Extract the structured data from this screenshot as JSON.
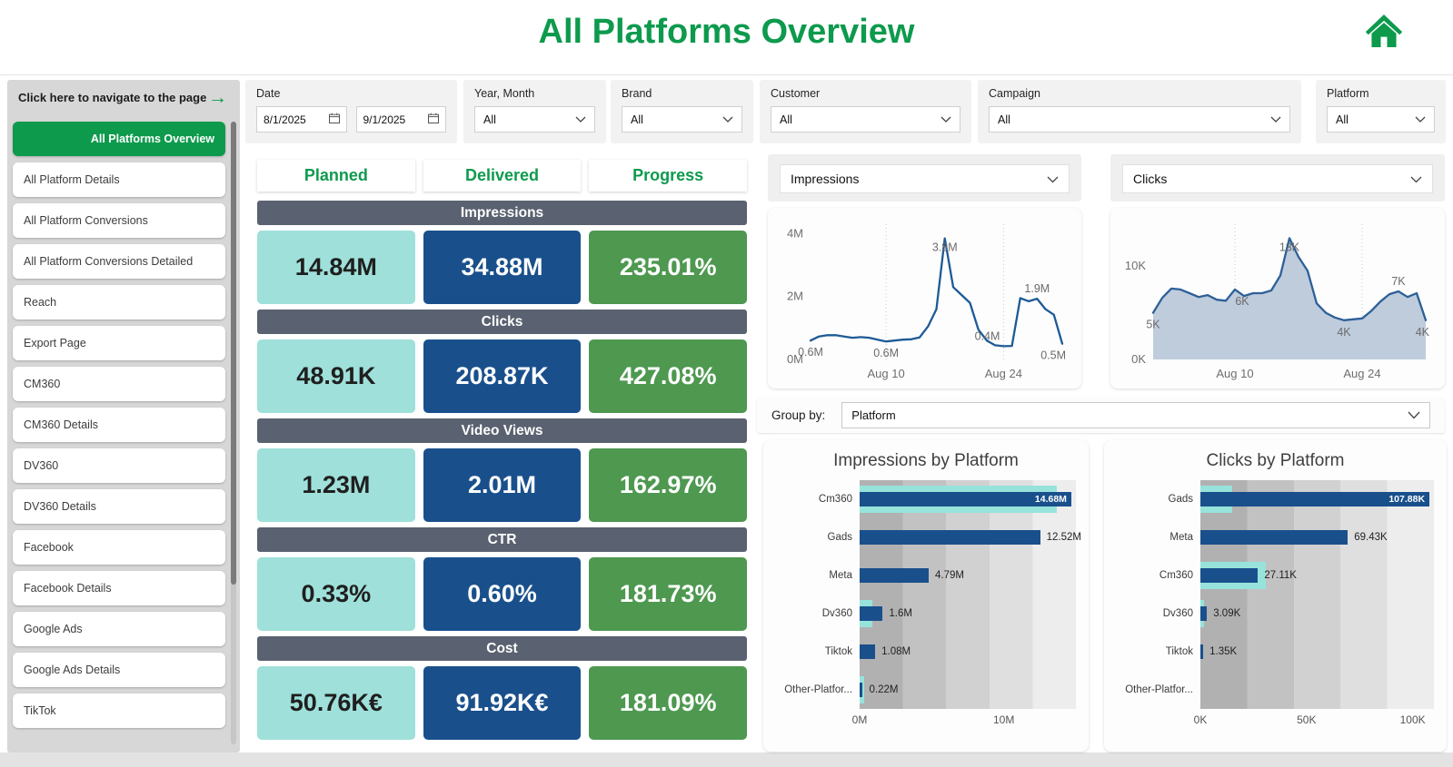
{
  "header": {
    "title": "All Platforms Overview"
  },
  "sidebar": {
    "nav_hint": "Click here to navigate to the page",
    "items": [
      {
        "label": "All Platforms Overview",
        "active": true
      },
      {
        "label": "All Platform Details",
        "active": false
      },
      {
        "label": "All Platform Conversions",
        "active": false
      },
      {
        "label": "All Platform Conversions Detailed",
        "active": false
      },
      {
        "label": "Reach",
        "active": false
      },
      {
        "label": "Export Page",
        "active": false
      },
      {
        "label": "CM360",
        "active": false
      },
      {
        "label": "CM360 Details",
        "active": false
      },
      {
        "label": "DV360",
        "active": false
      },
      {
        "label": "DV360 Details",
        "active": false
      },
      {
        "label": "Facebook",
        "active": false
      },
      {
        "label": "Facebook Details",
        "active": false
      },
      {
        "label": "Google Ads",
        "active": false
      },
      {
        "label": "Google Ads Details",
        "active": false
      },
      {
        "label": "TikTok",
        "active": false
      }
    ]
  },
  "filters": [
    {
      "label": "Date",
      "type": "daterange",
      "from": "8/1/2025",
      "to": "9/1/2025"
    },
    {
      "label": "Year, Month",
      "type": "dropdown",
      "value": "All"
    },
    {
      "label": "Brand",
      "type": "dropdown",
      "value": "All"
    },
    {
      "label": "Customer",
      "type": "dropdown",
      "value": "All"
    },
    {
      "label": "Campaign",
      "type": "dropdown",
      "value": "All"
    },
    {
      "label": "Platform",
      "type": "dropdown",
      "value": "All"
    }
  ],
  "kpi": {
    "columns": [
      "Planned",
      "Delivered",
      "Progress"
    ],
    "metrics": [
      {
        "name": "Impressions",
        "planned": "14.84M",
        "delivered": "34.88M",
        "progress": "235.01%"
      },
      {
        "name": "Clicks",
        "planned": "48.91K",
        "delivered": "208.87K",
        "progress": "427.08%"
      },
      {
        "name": "Video Views",
        "planned": "1.23M",
        "delivered": "2.01M",
        "progress": "162.97%"
      },
      {
        "name": "CTR",
        "planned": "0.33%",
        "delivered": "0.60%",
        "progress": "181.73%"
      },
      {
        "name": "Cost",
        "planned": "50.76K€",
        "delivered": "91.92K€",
        "progress": "181.09%"
      }
    ]
  },
  "group_by": {
    "label": "Group by:",
    "value": "Platform"
  },
  "chart_data": [
    {
      "type": "line",
      "selector_label": "Impressions",
      "x_range": "Aug 1 - Aug 31",
      "unit": "M",
      "values": [
        0.6,
        0.73,
        0.77,
        0.77,
        0.73,
        0.69,
        0.71,
        0.69,
        0.63,
        0.57,
        0.6,
        0.63,
        0.64,
        0.7,
        1.05,
        1.6,
        3.85,
        2.3,
        2.05,
        1.8,
        0.95,
        0.6,
        0.45,
        0.42,
        0.43,
        1.95,
        1.85,
        1.93,
        1.6,
        1.42,
        0.5
      ],
      "ylim": [
        0,
        4.3
      ],
      "yticks": [
        {
          "v": 0,
          "label": "0M"
        },
        {
          "v": 2,
          "label": "2M"
        },
        {
          "v": 4,
          "label": "4M"
        }
      ],
      "xticks": [
        {
          "i": 9,
          "label": "Aug 10"
        },
        {
          "i": 23,
          "label": "Aug 24"
        }
      ],
      "point_labels": [
        {
          "i": 0,
          "text": "0.6M",
          "pos": "below"
        },
        {
          "i": 9,
          "text": "0.6M",
          "pos": "below"
        },
        {
          "i": 16,
          "text": "3.8M",
          "pos": "peak"
        },
        {
          "i": 23,
          "text": "0.4M",
          "pos": "above",
          "anchor": "end",
          "dx": -4
        },
        {
          "i": 27,
          "text": "1.9M",
          "pos": "above"
        },
        {
          "i": 30,
          "text": "0.5M",
          "pos": "below",
          "anchor": "end",
          "dx": 4
        }
      ],
      "fill": false
    },
    {
      "type": "area",
      "selector_label": "Clicks",
      "x_range": "Aug 1 - Aug 31",
      "unit": "K",
      "values": [
        5.0,
        6.6,
        7.6,
        7.5,
        7.1,
        6.7,
        6.9,
        6.4,
        6.3,
        7.5,
        6.8,
        7.1,
        7.1,
        7.4,
        9.0,
        13.0,
        11.0,
        9.5,
        6.0,
        5.0,
        4.5,
        4.2,
        4.3,
        4.4,
        5.2,
        6.2,
        7.0,
        7.3,
        6.7,
        7.1,
        4.2
      ],
      "ylim": [
        0,
        14.5
      ],
      "yticks": [
        {
          "v": 0,
          "label": "0K"
        },
        {
          "v": 10,
          "label": "10K"
        }
      ],
      "xticks": [
        {
          "i": 9,
          "label": "Aug 10"
        },
        {
          "i": 23,
          "label": "Aug 24"
        }
      ],
      "point_labels": [
        {
          "i": 0,
          "text": "5K",
          "pos": "below"
        },
        {
          "i": 9,
          "text": "6K",
          "pos": "below",
          "dx": 8
        },
        {
          "i": 15,
          "text": "13K",
          "pos": "peak"
        },
        {
          "i": 21,
          "text": "4K",
          "pos": "below"
        },
        {
          "i": 27,
          "text": "7K",
          "pos": "above"
        },
        {
          "i": 30,
          "text": "4K",
          "pos": "below",
          "anchor": "end",
          "dx": 4
        }
      ],
      "fill": true
    },
    {
      "type": "bar",
      "title": "Impressions by Platform",
      "max": 15,
      "ticks": [
        {
          "v": 0,
          "label": "0M"
        },
        {
          "v": 10,
          "label": "10M"
        }
      ],
      "rows": [
        {
          "category": "Cm360",
          "planned": 13.7,
          "delivered": 14.68,
          "label": "14.68M",
          "inside": true
        },
        {
          "category": "Gads",
          "planned": 0,
          "delivered": 12.52,
          "label": "12.52M",
          "inside": false
        },
        {
          "category": "Meta",
          "planned": 0,
          "delivered": 4.79,
          "label": "4.79M",
          "inside": false
        },
        {
          "category": "Dv360",
          "planned": 0.9,
          "delivered": 1.6,
          "label": "1.6M",
          "inside": false
        },
        {
          "category": "Tiktok",
          "planned": 0,
          "delivered": 1.08,
          "label": "1.08M",
          "inside": false
        },
        {
          "category": "Other-Platfor...",
          "planned": 0.3,
          "delivered": 0.22,
          "label": "0.22M",
          "inside": false
        }
      ]
    },
    {
      "type": "bar",
      "title": "Clicks by Platform",
      "max": 110,
      "ticks": [
        {
          "v": 0,
          "label": "0K"
        },
        {
          "v": 50,
          "label": "50K"
        },
        {
          "v": 100,
          "label": "100K"
        }
      ],
      "rows": [
        {
          "category": "Gads",
          "planned": 15,
          "delivered": 107.88,
          "label": "107.88K",
          "inside": true
        },
        {
          "category": "Meta",
          "planned": 0,
          "delivered": 69.43,
          "label": "69.43K",
          "inside": false
        },
        {
          "category": "Cm360",
          "planned": 31,
          "delivered": 27.11,
          "label": "27.11K",
          "inside": false
        },
        {
          "category": "Dv360",
          "planned": 1.6,
          "delivered": 3.09,
          "label": "3.09K",
          "inside": false
        },
        {
          "category": "Tiktok",
          "planned": 0,
          "delivered": 1.35,
          "label": "1.35K",
          "inside": false
        },
        {
          "category": "Other-Platfor...",
          "planned": 0,
          "delivered": 0,
          "label": "",
          "inside": false
        }
      ]
    }
  ],
  "colors": {
    "brand_green": "#0d9a4d",
    "kpi_planned": "#9fe0da",
    "kpi_delivered": "#19508c",
    "kpi_progress": "#4e9850",
    "band_gray": "#5a6170",
    "line_blue": "#1e5a96",
    "area_fill": "#b8c6d8",
    "area_line": "#2d6097",
    "bar_teal": "#97e3dc",
    "bar_blue": "#19508c",
    "stripes": [
      "#b1b1b1",
      "#c2c2c2",
      "#d1d1d1",
      "#dfdfdf",
      "#ededed"
    ]
  }
}
